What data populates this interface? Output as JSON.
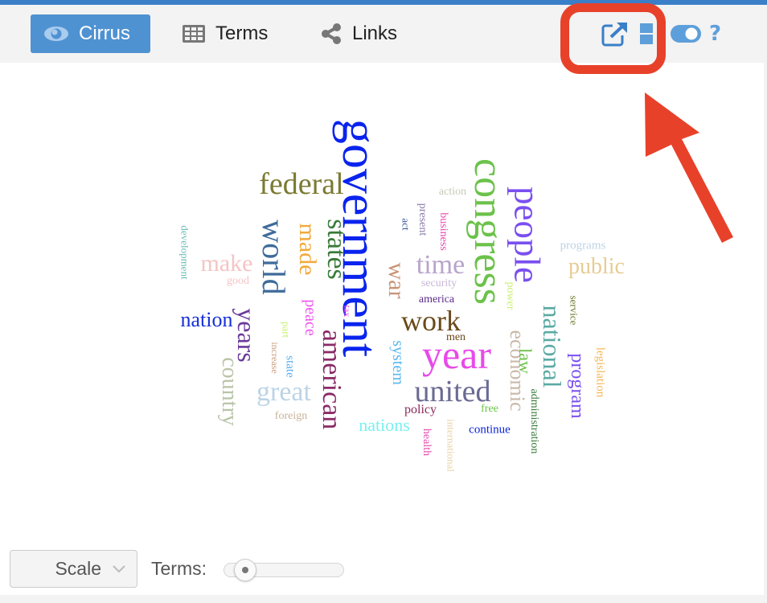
{
  "toolbar": {
    "tabs": [
      {
        "label": "Cirrus",
        "icon": "eye-icon",
        "active": true
      },
      {
        "label": "Terms",
        "icon": "table-grid-icon",
        "active": false
      },
      {
        "label": "Links",
        "icon": "share-nodes-icon",
        "active": false
      }
    ],
    "tools": [
      {
        "name": "export",
        "icon": "external-link-icon"
      },
      {
        "name": "switch-tool",
        "icon": "window-panes-icon"
      },
      {
        "name": "options",
        "icon": "toggle-icon"
      },
      {
        "name": "help",
        "icon": "question-icon",
        "glyph": "?"
      }
    ],
    "accent_color": "#4f92d2",
    "topbar_color": "#3a7fc8"
  },
  "annotation": {
    "highlight_color": "#e8412a",
    "target": "export"
  },
  "cloud": {
    "words": [
      {
        "text": "government",
        "color": "#0a24ee"
      },
      {
        "text": "congress",
        "color": "#6cc24a"
      },
      {
        "text": "people",
        "color": "#7a4ff0"
      },
      {
        "text": "federal",
        "color": "#7b7a32"
      },
      {
        "text": "world",
        "color": "#3e6b9a"
      },
      {
        "text": "states",
        "color": "#3a7a3a"
      },
      {
        "text": "made",
        "color": "#f2a93b"
      },
      {
        "text": "american",
        "color": "#8a2a66"
      },
      {
        "text": "years",
        "color": "#6a3a9a"
      },
      {
        "text": "country",
        "color": "#b8c4a8"
      },
      {
        "text": "make",
        "color": "#f5c4c4"
      },
      {
        "text": "good",
        "color": "#f5c4c4"
      },
      {
        "text": "development",
        "color": "#6abcb4"
      },
      {
        "text": "nation",
        "color": "#1630d8"
      },
      {
        "text": "peace",
        "color": "#ee55ee"
      },
      {
        "text": "tax",
        "color": "#ee55ee"
      },
      {
        "text": "part",
        "color": "#c8f070"
      },
      {
        "text": "increase",
        "color": "#c89a7c"
      },
      {
        "text": "state",
        "color": "#5ab0f0"
      },
      {
        "text": "great",
        "color": "#bcd4e6"
      },
      {
        "text": "foreign",
        "color": "#c8b49a"
      },
      {
        "text": "war",
        "color": "#c89478"
      },
      {
        "text": "time",
        "color": "#b8a4cc"
      },
      {
        "text": "security",
        "color": "#c8b8d8"
      },
      {
        "text": "america",
        "color": "#5a2a8a"
      },
      {
        "text": "work",
        "color": "#6a4a1a"
      },
      {
        "text": "men",
        "color": "#6a4a1a"
      },
      {
        "text": "year",
        "color": "#e84ae8"
      },
      {
        "text": "system",
        "color": "#5ab8f0"
      },
      {
        "text": "united",
        "color": "#6a6a94"
      },
      {
        "text": "policy",
        "color": "#8a2a5a"
      },
      {
        "text": "free",
        "color": "#6cc24a"
      },
      {
        "text": "nations",
        "color": "#7af0f0"
      },
      {
        "text": "health",
        "color": "#e84ab0"
      },
      {
        "text": "international",
        "color": "#e8d4a8"
      },
      {
        "text": "continue",
        "color": "#0a24d8"
      },
      {
        "text": "action",
        "color": "#c8c8b4"
      },
      {
        "text": "present",
        "color": "#8a7aaa"
      },
      {
        "text": "act",
        "color": "#3e5a9a"
      },
      {
        "text": "business",
        "color": "#e84ab0"
      },
      {
        "text": "power",
        "color": "#c8f070"
      },
      {
        "text": "economic",
        "color": "#c8b8a8"
      },
      {
        "text": "law",
        "color": "#6cc24a"
      },
      {
        "text": "national",
        "color": "#5aaaa4"
      },
      {
        "text": "service",
        "color": "#6a7a2a"
      },
      {
        "text": "program",
        "color": "#7a4ff0"
      },
      {
        "text": "legislation",
        "color": "#f2b85a"
      },
      {
        "text": "administration",
        "color": "#3a7a3a"
      },
      {
        "text": "programs",
        "color": "#bcd4e6"
      },
      {
        "text": "public",
        "color": "#e6cc94"
      }
    ]
  },
  "footer": {
    "scale_select": {
      "value": "Scale"
    },
    "terms_label": "Terms:",
    "terms_slider": {
      "fraction": 0.05
    }
  }
}
